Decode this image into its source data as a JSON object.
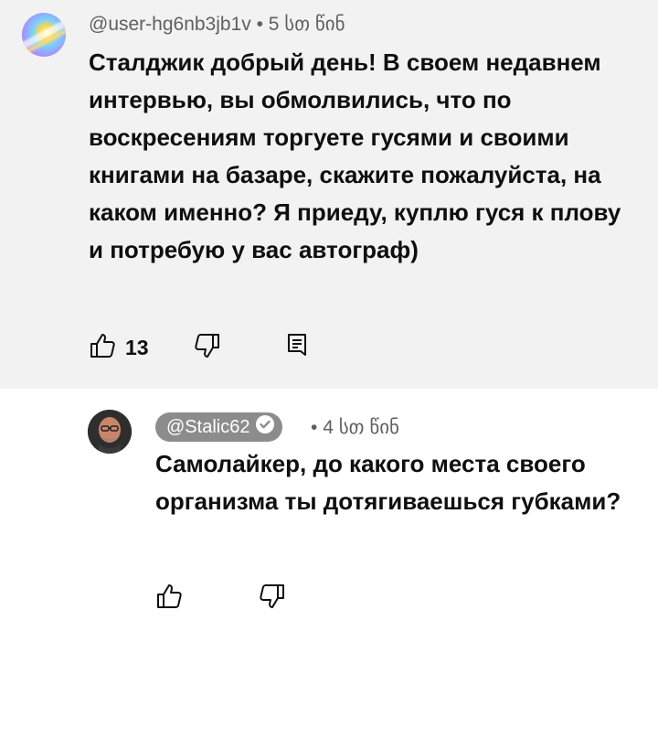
{
  "comment": {
    "author": "@user-hg6nb3jb1v",
    "separator": " • ",
    "time": "5 სთ წინ",
    "text": "Сталджик добрый день! В своем недавнем интервью, вы обмолвились, что по воскресениям торгуете гусями и своими книгами на базаре, скажите пожалуйста, на каком именно? Я приеду, куплю гуся  к плову и потребую у вас автограф)",
    "likes": "13",
    "icons": {
      "like": "thumbs-up-icon",
      "dislike": "thumbs-down-icon",
      "reply": "comment-icon"
    }
  },
  "reply": {
    "author": "@Stalic62",
    "verified_icon": "verified-check-icon",
    "separator": " • ",
    "time": "4 სთ წინ",
    "text": "Самолайкер, до какого места своего организма ты дотягиваешься губками?",
    "icons": {
      "like": "thumbs-up-icon",
      "dislike": "thumbs-down-icon"
    },
    "chip_color": "#8c8c8c"
  }
}
